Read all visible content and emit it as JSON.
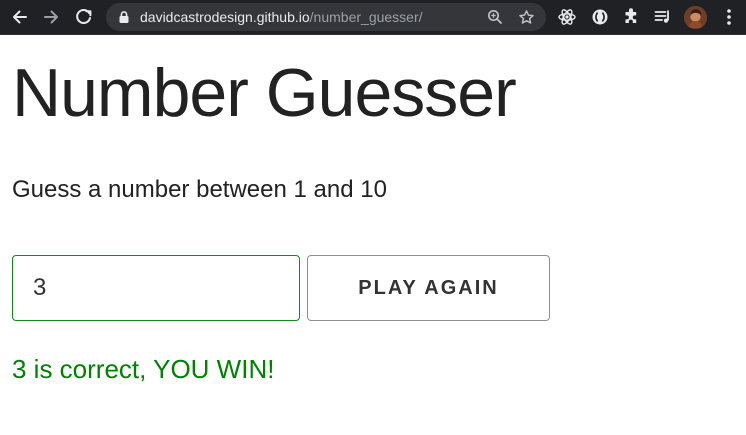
{
  "browser": {
    "url_domain": "davidcastrodesign.github.io",
    "url_path": "/number_guesser/",
    "icons": {
      "back": "back-arrow-icon",
      "forward": "forward-arrow-icon",
      "reload": "reload-icon",
      "lock": "lock-icon",
      "zoom": "zoom-icon",
      "bookmark": "star-icon",
      "react_extension": "react-icon",
      "extension": "circle-extension-icon",
      "extensions_menu": "puzzle-icon",
      "media_controls": "playlist-icon",
      "profile": "avatar",
      "menu": "more-vert-icon"
    }
  },
  "page": {
    "title": "Number Guesser",
    "instructions": "Guess a number between 1 and 10",
    "guess_input": {
      "value": "3"
    },
    "play_again_label": "PLAY AGAIN",
    "result_message": "3 is correct, YOU WIN!"
  },
  "colors": {
    "browser_bar": "#202124",
    "omnibox": "#35363a",
    "input_border": "#118a20",
    "success_text": "#008000",
    "button_border": "#8f8f8f",
    "title_text": "#222222"
  }
}
